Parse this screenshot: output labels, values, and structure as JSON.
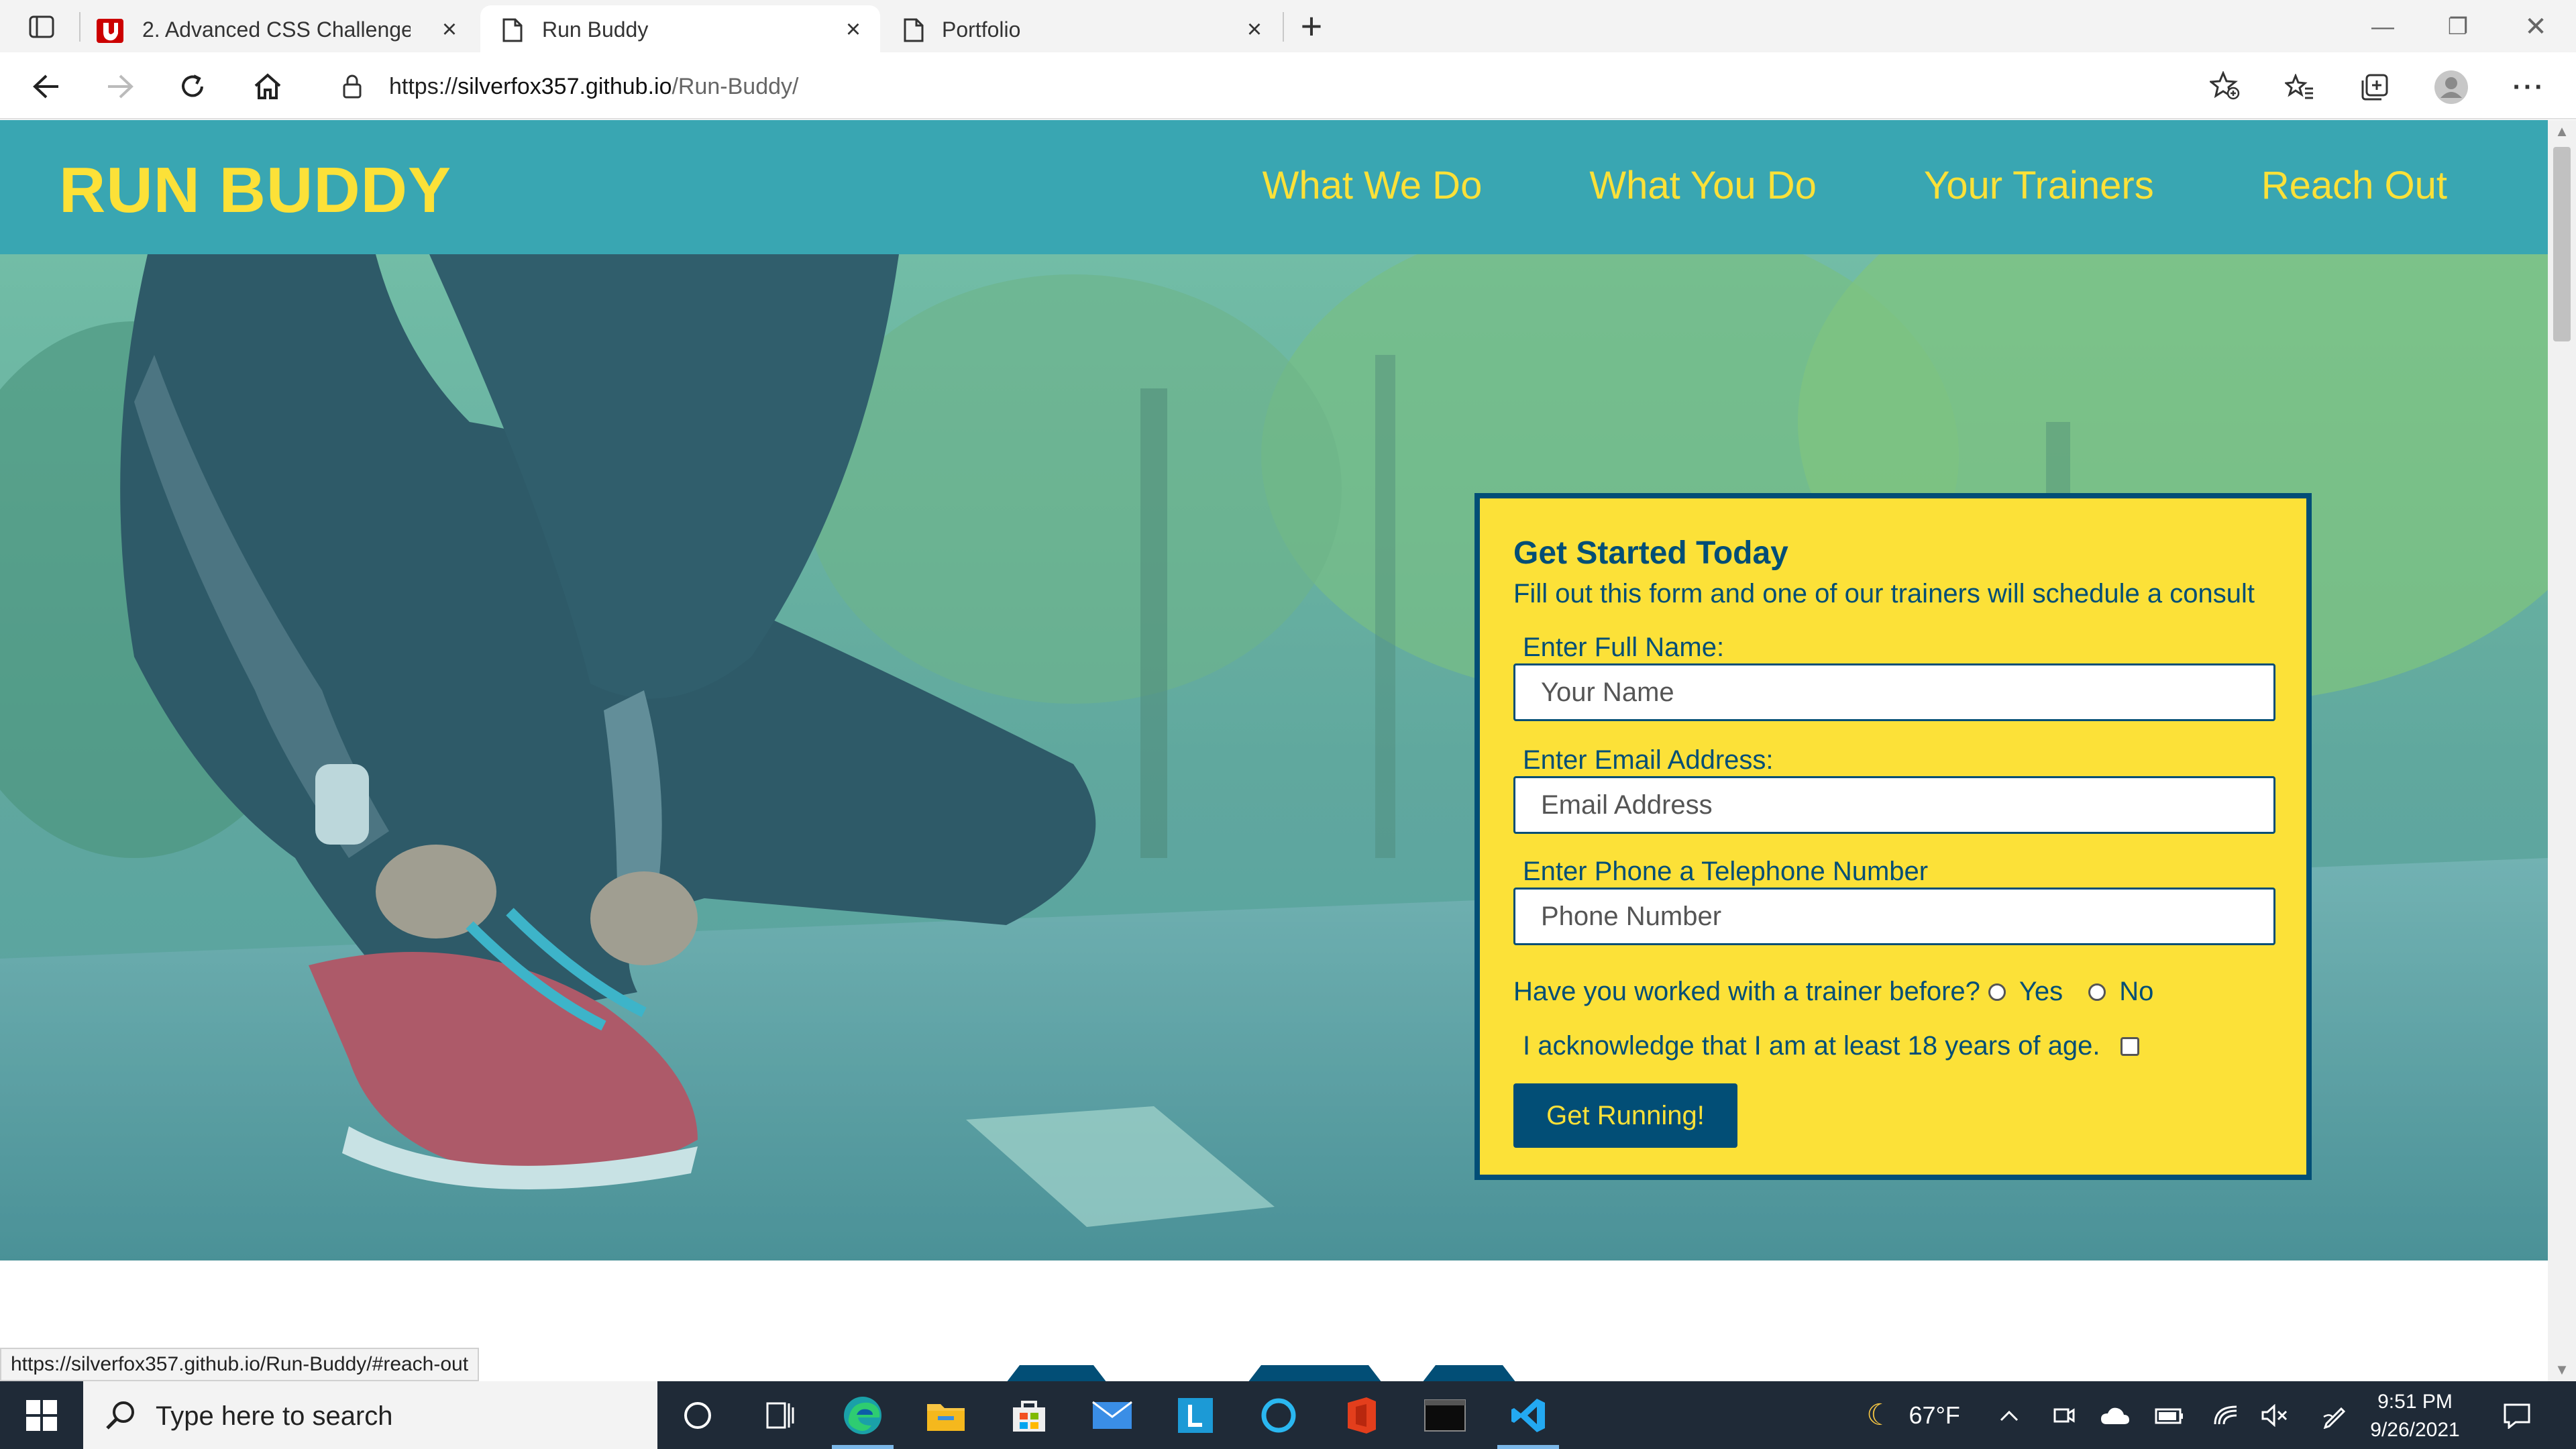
{
  "browser": {
    "tabs": [
      {
        "title": "2. Advanced CSS Challenge: Prof",
        "active": false,
        "icon": "u-logo-icon"
      },
      {
        "title": "Run Buddy",
        "active": true,
        "icon": "page-icon"
      },
      {
        "title": "Portfolio",
        "active": false,
        "icon": "page-icon"
      }
    ],
    "url_scheme": "https://",
    "url_host": "silverfox357.github.io",
    "url_path": "/Run-Buddy/",
    "status_url": "https://silverfox357.github.io/Run-Buddy/#reach-out"
  },
  "site": {
    "logo": "RUN BUDDY",
    "nav": [
      "What We Do",
      "What You Do",
      "Your Trainers",
      "Reach Out"
    ]
  },
  "form": {
    "title": "Get Started Today",
    "subtitle": "Fill out this form and one of our trainers will schedule a consult",
    "name_label": "Enter Full Name:",
    "name_placeholder": "Your Name",
    "email_label": "Enter Email Address:",
    "email_placeholder": "Email Address",
    "phone_label": "Enter Phone a Telephone Number",
    "phone_placeholder": "Phone Number",
    "trainer_question": "Have you worked with a trainer before?",
    "yes_label": "Yes",
    "no_label": "No",
    "age_ack": "I acknowledge that I am at least 18 years of age.",
    "submit_label": "Get Running!"
  },
  "taskbar": {
    "search_placeholder": "Type here to search",
    "weather": "67°F",
    "time": "9:51 PM",
    "date": "9/26/2021"
  },
  "colors": {
    "header": "#39a6b2",
    "accent_yellow": "#fce138",
    "dark_blue": "#024e76"
  }
}
